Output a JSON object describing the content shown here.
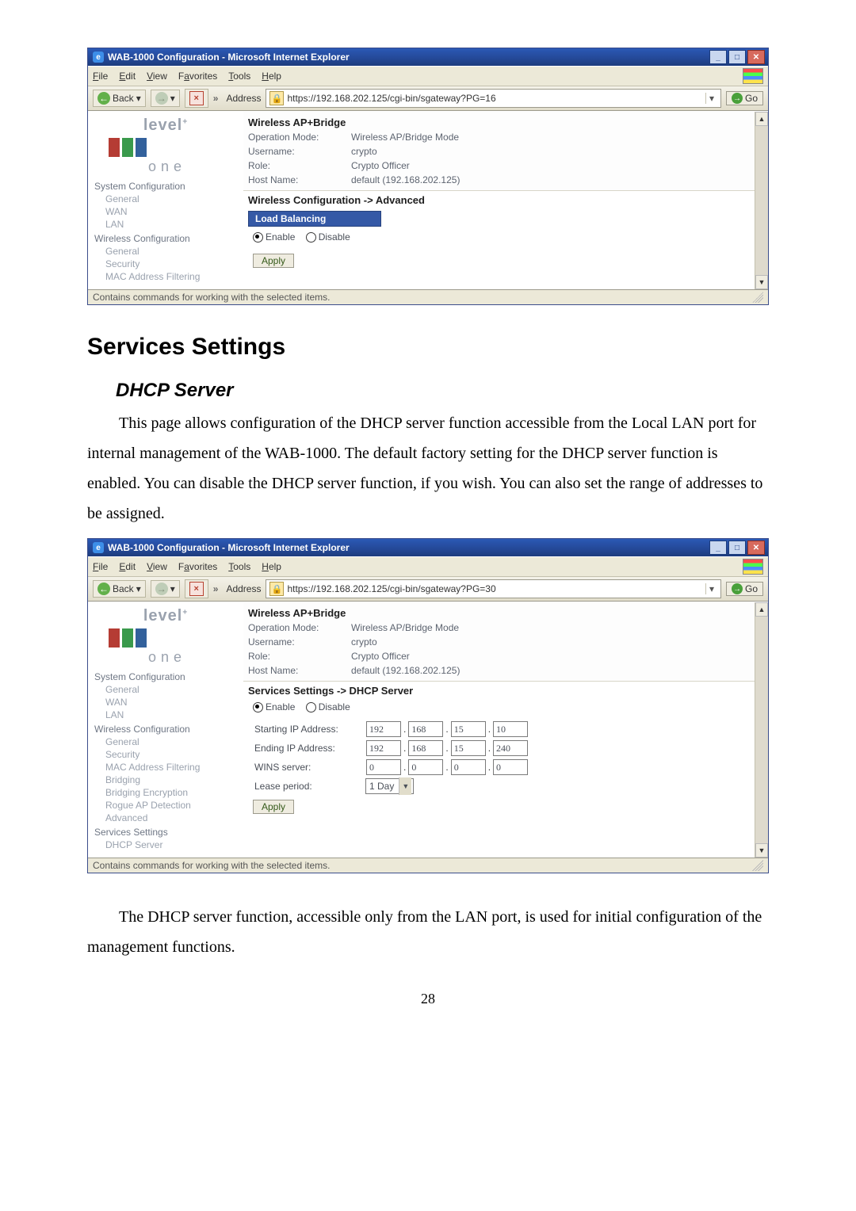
{
  "page_number": "28",
  "doc": {
    "h2": "Services Settings",
    "h3": "DHCP Server",
    "p1": "This page allows configuration of the DHCP server function accessible from the Local LAN port for internal management of the WAB-1000. The default factory setting for the DHCP server function is enabled. You can disable the DHCP server function, if you wish. You can also set the range of addresses to be assigned.",
    "p2": "The DHCP server function, accessible only from the LAN port, is used for initial configuration of the management functions."
  },
  "ie_common": {
    "title_prefix": "WAB-1000 Configuration - Microsoft Internet Explorer",
    "menus": {
      "file": "File",
      "edit": "Edit",
      "view": "View",
      "favorites": "Favorites",
      "tools": "Tools",
      "help": "Help"
    },
    "back": "Back",
    "address_label": "Address",
    "go": "Go",
    "status": "Contains commands for working with the selected items.",
    "brand_top": "level",
    "brand_bottom": "one",
    "header_title": "Wireless AP+Bridge",
    "kv": {
      "op_mode_k": "Operation Mode:",
      "op_mode_v": "Wireless AP/Bridge Mode",
      "user_k": "Username:",
      "user_v": "crypto",
      "role_k": "Role:",
      "role_v": "Crypto Officer",
      "host_k": "Host Name:",
      "host_v": "default (192.168.202.125)"
    },
    "nav_labels": {
      "syscfg": "System Configuration",
      "general": "General",
      "wan": "WAN",
      "lan": "LAN",
      "wcfg": "Wireless Configuration",
      "security": "Security",
      "macf": "MAC Address Filtering",
      "bridging": "Bridging",
      "brenc": "Bridging Encryption",
      "rogue": "Rogue AP Detection",
      "advanced": "Advanced",
      "services": "Services Settings",
      "dhcp": "DHCP Server"
    },
    "enable": "Enable",
    "disable": "Disable",
    "apply": "Apply"
  },
  "shot1": {
    "url": "https://192.168.202.125/cgi-bin/sgateway?PG=16",
    "breadcrumb": "Wireless Configuration -> Advanced",
    "panel": "Load Balancing"
  },
  "shot2": {
    "url": "https://192.168.202.125/cgi-bin/sgateway?PG=30",
    "breadcrumb": "Services Settings -> DHCP Server",
    "labels": {
      "start_ip": "Starting IP Address:",
      "end_ip": "Ending IP Address:",
      "wins": "WINS server:",
      "lease": "Lease period:"
    },
    "start_ip": [
      "192",
      "168",
      "15",
      "10"
    ],
    "end_ip": [
      "192",
      "168",
      "15",
      "240"
    ],
    "wins": [
      "0",
      "0",
      "0",
      "0"
    ],
    "lease": "1 Day"
  }
}
